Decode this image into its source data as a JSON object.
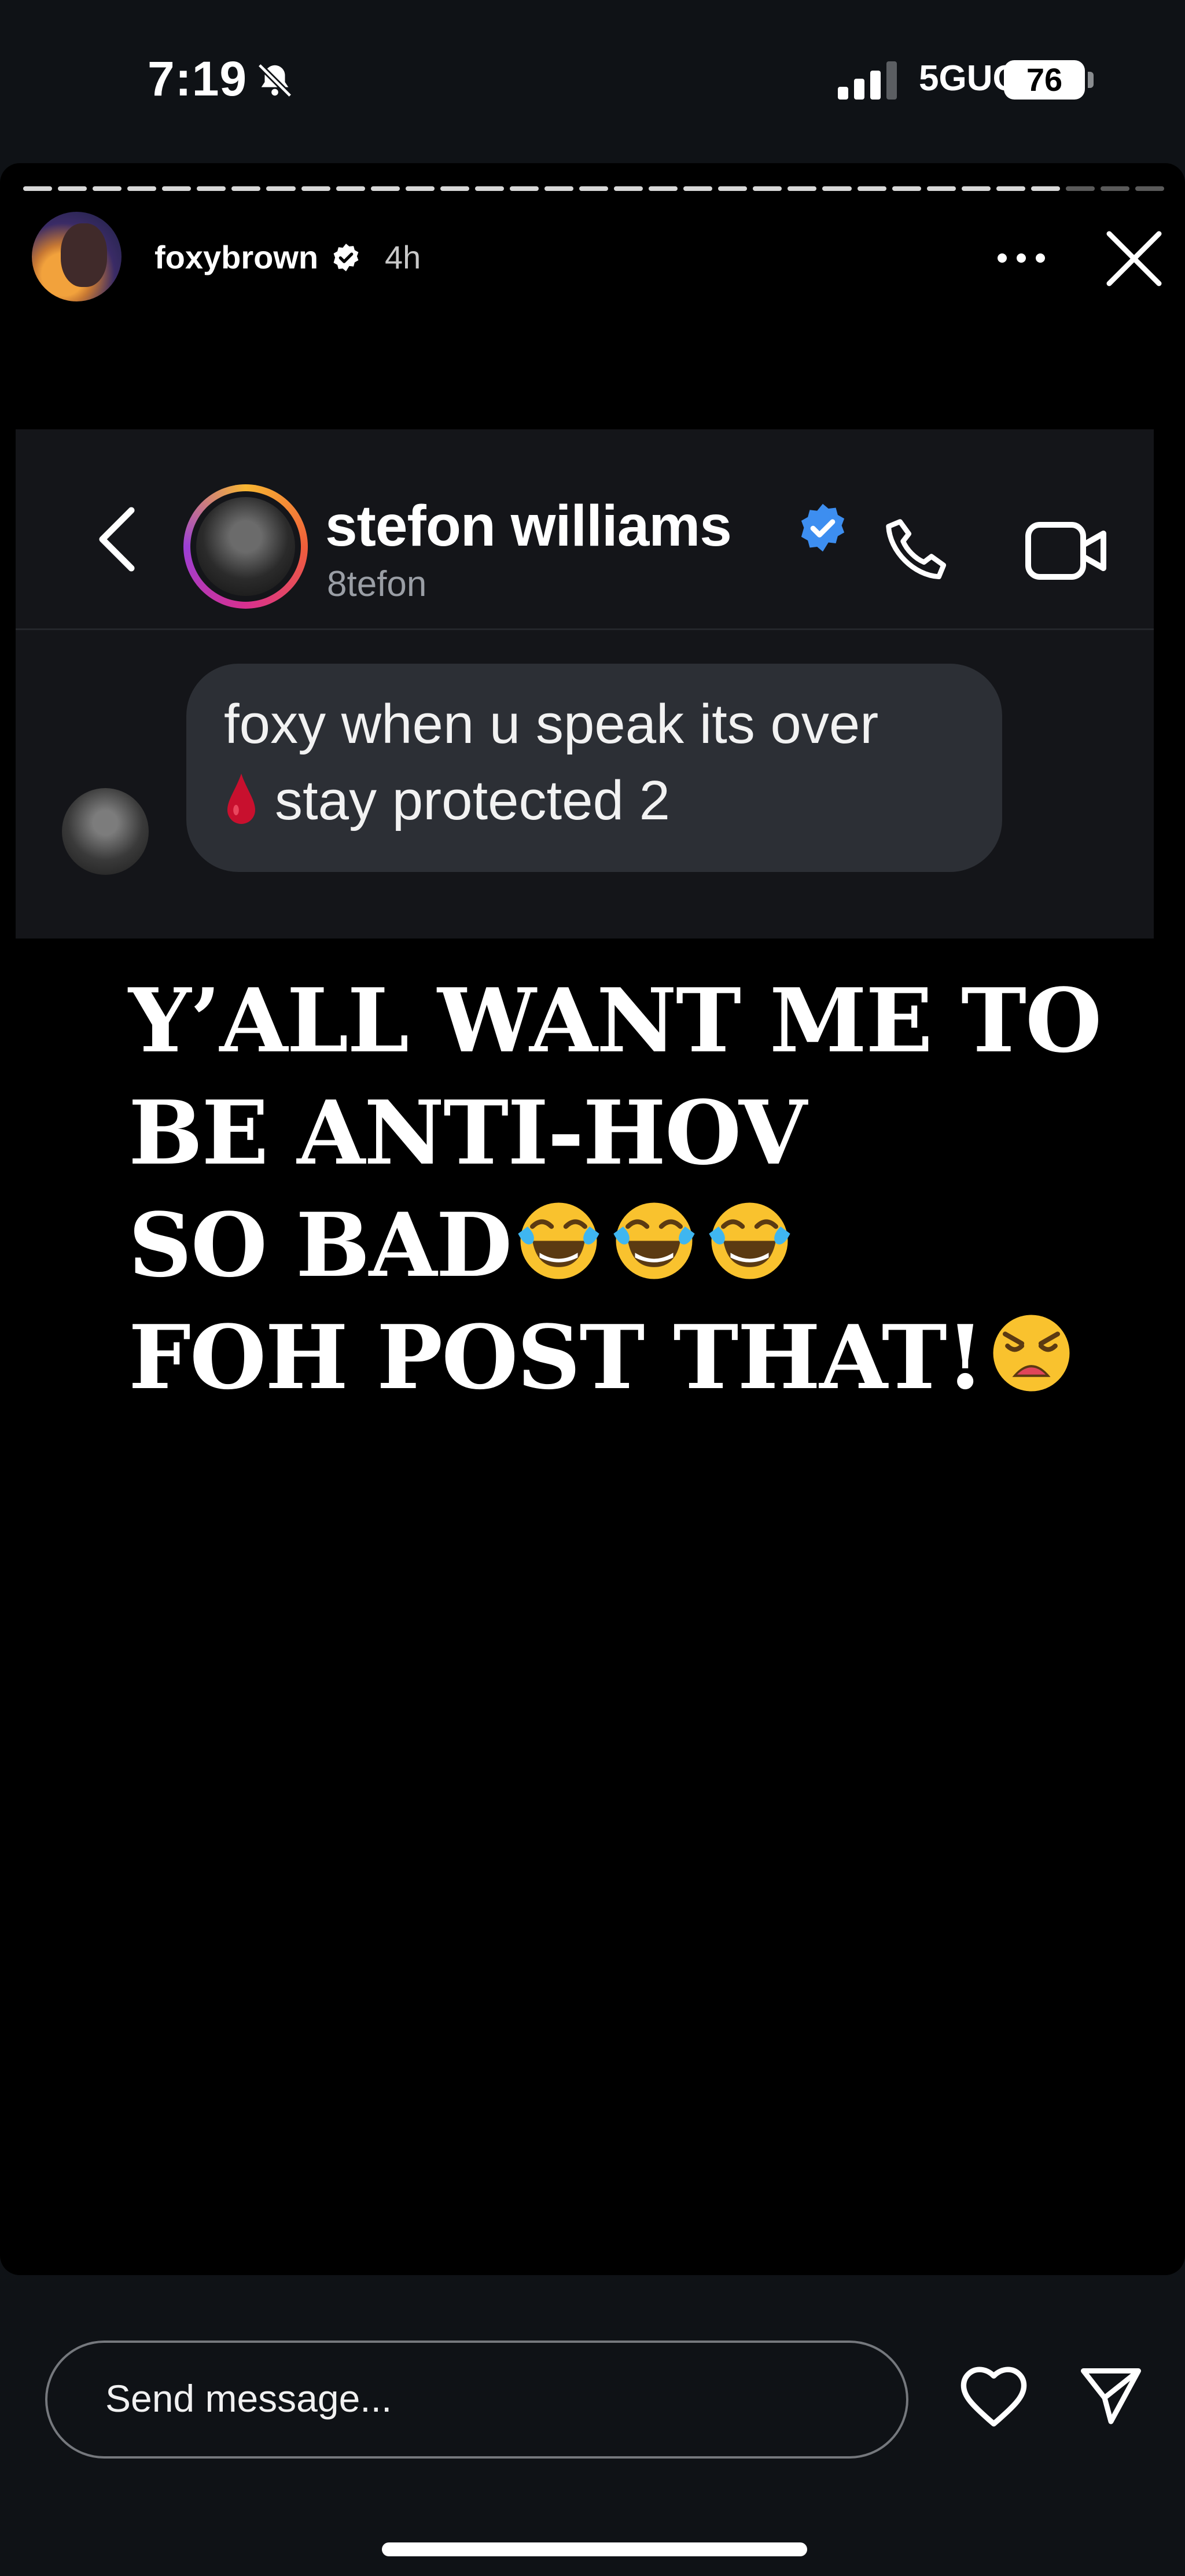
{
  "status_bar": {
    "time": "7:19",
    "network": "5GUC",
    "battery": "76"
  },
  "story": {
    "username": "foxybrown",
    "time_ago": "4h",
    "progress_segments_total": 33,
    "progress_segments_viewed": 30
  },
  "dm_screenshot": {
    "contact_name": "stefon williams",
    "contact_handle": "8tefon",
    "message_line1": "foxy when u speak its over",
    "message_line2": "stay protected 2"
  },
  "caption": {
    "line1": "Y’ALL WANT ME TO",
    "line2": "BE ANTI-HOV",
    "line3": "SO BAD",
    "line4": "FOH POST THAT!"
  },
  "reply_bar": {
    "placeholder": "Send message..."
  },
  "colors": {
    "verified_blue": "#3d8ef0",
    "blood_red": "#c8102e",
    "emoji_yellow": "#f9c22e"
  }
}
